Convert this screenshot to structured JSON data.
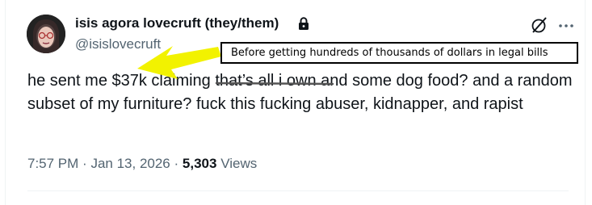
{
  "tweet": {
    "display_name": "isis agora lovecruft (they/them)",
    "handle": "@isislovecruft",
    "body": "he sent me $37k claiming that’s all i own and some dog food? and a random subset of my furniture? fuck this fucking abuser, kidnapper, and rapist",
    "time": "7:57 PM",
    "separator": "·",
    "date": "Jan 13, 2026",
    "views_count": "5,303",
    "views_label": "Views"
  },
  "annotation": {
    "text": "Before getting hundreds of thousands of dollars in legal bills"
  },
  "icons": {
    "lock": "lock-icon",
    "grok": "grok-icon",
    "more": "more-icon"
  },
  "colors": {
    "text": "#0f1419",
    "secondary": "#536471",
    "arrow": "#f2f200"
  }
}
